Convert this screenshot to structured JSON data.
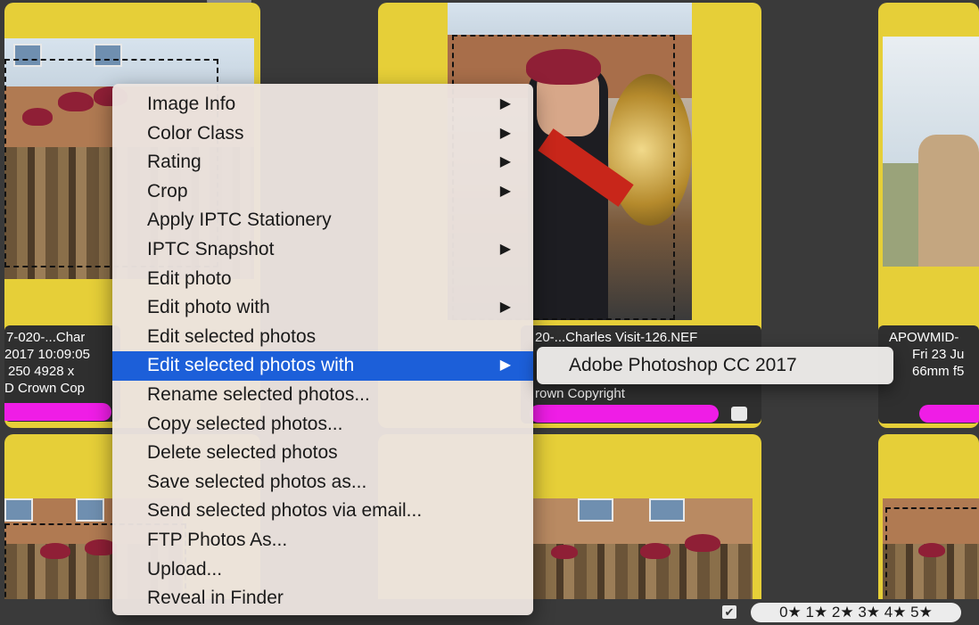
{
  "thumbnails": [
    {
      "caption_line1": "7-020-...Char",
      "caption_line2": "2017   10:09:05",
      "caption_line3": "250   4928 x",
      "caption_line4": "D Crown Cop"
    },
    {
      "caption_line1": "20-...Charles Visit-126.NEF",
      "caption_line4": "rown Copyright"
    },
    {
      "caption_line1": "APOWMID-",
      "caption_line2": "Fri 23 Ju",
      "caption_line3": "66mm f5"
    }
  ],
  "context_menu": {
    "items": [
      {
        "label": "Image Info",
        "submenu": true
      },
      {
        "label": "Color Class",
        "submenu": true
      },
      {
        "label": "Rating",
        "submenu": true
      },
      {
        "label": "Crop",
        "submenu": true
      },
      {
        "label": "Apply IPTC Stationery",
        "submenu": false
      },
      {
        "label": "IPTC Snapshot",
        "submenu": true
      },
      {
        "label": "Edit photo",
        "submenu": false
      },
      {
        "label": "Edit photo with",
        "submenu": true
      },
      {
        "label": "Edit selected photos",
        "submenu": false
      },
      {
        "label": "Edit selected photos with",
        "submenu": true,
        "highlighted": true
      },
      {
        "label": "Rename selected photos...",
        "submenu": false
      },
      {
        "label": "Copy selected photos...",
        "submenu": false
      },
      {
        "label": "Delete selected photos",
        "submenu": false
      },
      {
        "label": "Save selected photos as...",
        "submenu": false
      },
      {
        "label": "Send selected photos via email...",
        "submenu": false
      },
      {
        "label": "FTP Photos As...",
        "submenu": false
      },
      {
        "label": "Upload...",
        "submenu": false
      },
      {
        "label": "Reveal in Finder",
        "submenu": false
      }
    ],
    "arrow_glyph": "▶"
  },
  "submenu": {
    "items": [
      {
        "label": "Adobe Photoshop CC 2017"
      }
    ]
  },
  "bottom_bar": {
    "checkbox_glyph": "✔",
    "rating_filter": "0★ 1★ 2★ 3★ 4★ 5★"
  },
  "colors": {
    "card_yellow": "#e6cf38",
    "color_class_magenta": "#ef1de6",
    "menu_highlight": "#1c5fd9",
    "background": "#3a3a3a"
  }
}
